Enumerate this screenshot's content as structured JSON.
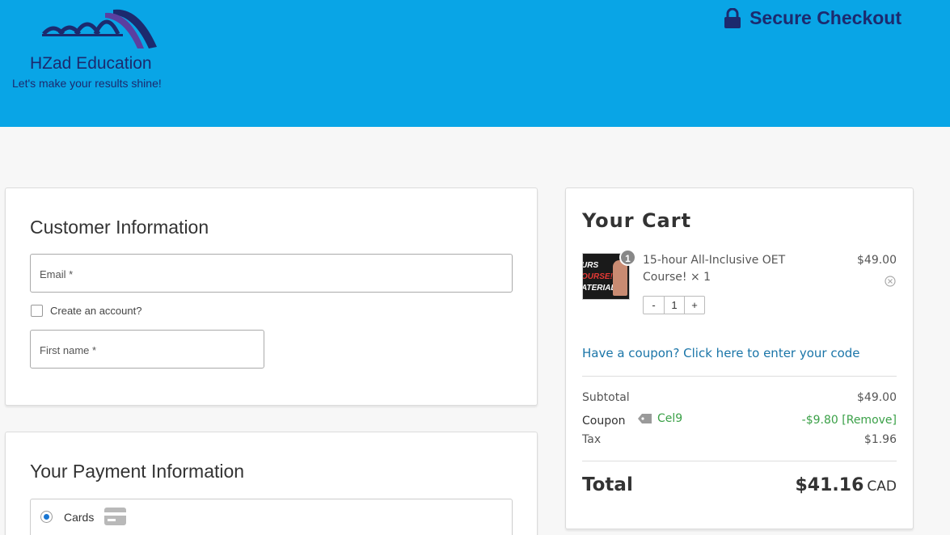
{
  "header": {
    "brand": "HZad Education",
    "tagline": "Let's make your results shine!",
    "secure_label": "Secure Checkout",
    "colors": {
      "bar": "#09a5e6",
      "navy": "#1c2a6e"
    }
  },
  "customer": {
    "title": "Customer Information",
    "email_label": "Email *",
    "create_account_label": "Create an account?",
    "first_name_label": "First name *"
  },
  "payment": {
    "title": "Your Payment Information",
    "method_label": "Cards",
    "method_icon": "credit-card-icon"
  },
  "cart": {
    "title": "Your Cart",
    "item": {
      "name": "15-hour All-Inclusive OET Course! × 1",
      "price": "$49.00",
      "badge": "1",
      "quantity": "1",
      "thumb_lines": [
        "URS",
        "OURSE!",
        "ATERIALS!"
      ]
    },
    "qty_minus": "-",
    "qty_plus": "+",
    "coupon_prompt": "Have a coupon? Click here to enter your code",
    "subtotal_label": "Subtotal",
    "subtotal_value": "$49.00",
    "coupon_label": "Coupon",
    "coupon_code": "Cel9",
    "coupon_value": "-$9.80 [Remove]",
    "tax_label": "Tax",
    "tax_value": "$1.96",
    "total_label": "Total",
    "total_value": "$41.16",
    "total_currency": "CAD",
    "colors": {
      "link": "#1a75a8",
      "discount": "#3aa047"
    }
  }
}
